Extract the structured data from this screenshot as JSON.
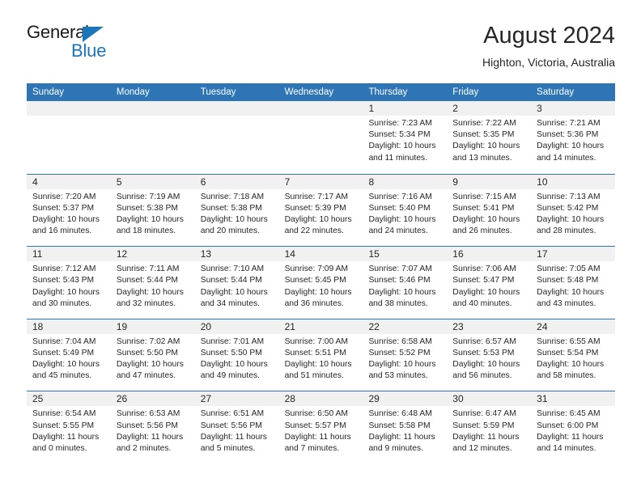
{
  "brand": {
    "name_part1": "General",
    "name_part2": "Blue",
    "accent_color": "#1b75bb"
  },
  "header": {
    "title": "August 2024",
    "subtitle": "Highton, Victoria, Australia"
  },
  "theme": {
    "header_row_color": "#2e75b6",
    "daynum_band_color": "#f1f1f1",
    "text_color": "#262626"
  },
  "weekday_headers": [
    "Sunday",
    "Monday",
    "Tuesday",
    "Wednesday",
    "Thursday",
    "Friday",
    "Saturday"
  ],
  "weeks": [
    [
      {
        "day": "",
        "lines": []
      },
      {
        "day": "",
        "lines": []
      },
      {
        "day": "",
        "lines": []
      },
      {
        "day": "",
        "lines": []
      },
      {
        "day": "1",
        "lines": [
          "Sunrise: 7:23 AM",
          "Sunset: 5:34 PM",
          "Daylight: 10 hours",
          "and 11 minutes."
        ]
      },
      {
        "day": "2",
        "lines": [
          "Sunrise: 7:22 AM",
          "Sunset: 5:35 PM",
          "Daylight: 10 hours",
          "and 13 minutes."
        ]
      },
      {
        "day": "3",
        "lines": [
          "Sunrise: 7:21 AM",
          "Sunset: 5:36 PM",
          "Daylight: 10 hours",
          "and 14 minutes."
        ]
      }
    ],
    [
      {
        "day": "4",
        "lines": [
          "Sunrise: 7:20 AM",
          "Sunset: 5:37 PM",
          "Daylight: 10 hours",
          "and 16 minutes."
        ]
      },
      {
        "day": "5",
        "lines": [
          "Sunrise: 7:19 AM",
          "Sunset: 5:38 PM",
          "Daylight: 10 hours",
          "and 18 minutes."
        ]
      },
      {
        "day": "6",
        "lines": [
          "Sunrise: 7:18 AM",
          "Sunset: 5:38 PM",
          "Daylight: 10 hours",
          "and 20 minutes."
        ]
      },
      {
        "day": "7",
        "lines": [
          "Sunrise: 7:17 AM",
          "Sunset: 5:39 PM",
          "Daylight: 10 hours",
          "and 22 minutes."
        ]
      },
      {
        "day": "8",
        "lines": [
          "Sunrise: 7:16 AM",
          "Sunset: 5:40 PM",
          "Daylight: 10 hours",
          "and 24 minutes."
        ]
      },
      {
        "day": "9",
        "lines": [
          "Sunrise: 7:15 AM",
          "Sunset: 5:41 PM",
          "Daylight: 10 hours",
          "and 26 minutes."
        ]
      },
      {
        "day": "10",
        "lines": [
          "Sunrise: 7:13 AM",
          "Sunset: 5:42 PM",
          "Daylight: 10 hours",
          "and 28 minutes."
        ]
      }
    ],
    [
      {
        "day": "11",
        "lines": [
          "Sunrise: 7:12 AM",
          "Sunset: 5:43 PM",
          "Daylight: 10 hours",
          "and 30 minutes."
        ]
      },
      {
        "day": "12",
        "lines": [
          "Sunrise: 7:11 AM",
          "Sunset: 5:44 PM",
          "Daylight: 10 hours",
          "and 32 minutes."
        ]
      },
      {
        "day": "13",
        "lines": [
          "Sunrise: 7:10 AM",
          "Sunset: 5:44 PM",
          "Daylight: 10 hours",
          "and 34 minutes."
        ]
      },
      {
        "day": "14",
        "lines": [
          "Sunrise: 7:09 AM",
          "Sunset: 5:45 PM",
          "Daylight: 10 hours",
          "and 36 minutes."
        ]
      },
      {
        "day": "15",
        "lines": [
          "Sunrise: 7:07 AM",
          "Sunset: 5:46 PM",
          "Daylight: 10 hours",
          "and 38 minutes."
        ]
      },
      {
        "day": "16",
        "lines": [
          "Sunrise: 7:06 AM",
          "Sunset: 5:47 PM",
          "Daylight: 10 hours",
          "and 40 minutes."
        ]
      },
      {
        "day": "17",
        "lines": [
          "Sunrise: 7:05 AM",
          "Sunset: 5:48 PM",
          "Daylight: 10 hours",
          "and 43 minutes."
        ]
      }
    ],
    [
      {
        "day": "18",
        "lines": [
          "Sunrise: 7:04 AM",
          "Sunset: 5:49 PM",
          "Daylight: 10 hours",
          "and 45 minutes."
        ]
      },
      {
        "day": "19",
        "lines": [
          "Sunrise: 7:02 AM",
          "Sunset: 5:50 PM",
          "Daylight: 10 hours",
          "and 47 minutes."
        ]
      },
      {
        "day": "20",
        "lines": [
          "Sunrise: 7:01 AM",
          "Sunset: 5:50 PM",
          "Daylight: 10 hours",
          "and 49 minutes."
        ]
      },
      {
        "day": "21",
        "lines": [
          "Sunrise: 7:00 AM",
          "Sunset: 5:51 PM",
          "Daylight: 10 hours",
          "and 51 minutes."
        ]
      },
      {
        "day": "22",
        "lines": [
          "Sunrise: 6:58 AM",
          "Sunset: 5:52 PM",
          "Daylight: 10 hours",
          "and 53 minutes."
        ]
      },
      {
        "day": "23",
        "lines": [
          "Sunrise: 6:57 AM",
          "Sunset: 5:53 PM",
          "Daylight: 10 hours",
          "and 56 minutes."
        ]
      },
      {
        "day": "24",
        "lines": [
          "Sunrise: 6:55 AM",
          "Sunset: 5:54 PM",
          "Daylight: 10 hours",
          "and 58 minutes."
        ]
      }
    ],
    [
      {
        "day": "25",
        "lines": [
          "Sunrise: 6:54 AM",
          "Sunset: 5:55 PM",
          "Daylight: 11 hours",
          "and 0 minutes."
        ]
      },
      {
        "day": "26",
        "lines": [
          "Sunrise: 6:53 AM",
          "Sunset: 5:56 PM",
          "Daylight: 11 hours",
          "and 2 minutes."
        ]
      },
      {
        "day": "27",
        "lines": [
          "Sunrise: 6:51 AM",
          "Sunset: 5:56 PM",
          "Daylight: 11 hours",
          "and 5 minutes."
        ]
      },
      {
        "day": "28",
        "lines": [
          "Sunrise: 6:50 AM",
          "Sunset: 5:57 PM",
          "Daylight: 11 hours",
          "and 7 minutes."
        ]
      },
      {
        "day": "29",
        "lines": [
          "Sunrise: 6:48 AM",
          "Sunset: 5:58 PM",
          "Daylight: 11 hours",
          "and 9 minutes."
        ]
      },
      {
        "day": "30",
        "lines": [
          "Sunrise: 6:47 AM",
          "Sunset: 5:59 PM",
          "Daylight: 11 hours",
          "and 12 minutes."
        ]
      },
      {
        "day": "31",
        "lines": [
          "Sunrise: 6:45 AM",
          "Sunset: 6:00 PM",
          "Daylight: 11 hours",
          "and 14 minutes."
        ]
      }
    ]
  ]
}
